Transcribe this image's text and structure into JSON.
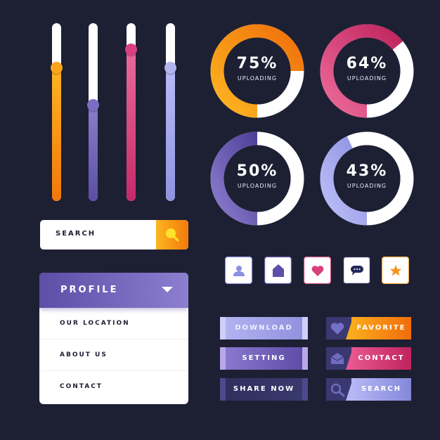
{
  "sliders": [
    {
      "name": "orange",
      "value": 0.75,
      "colors": [
        "#f2770b",
        "#fdb521"
      ],
      "knob": "#fba51b"
    },
    {
      "name": "purple",
      "value": 0.54,
      "colors": [
        "#5a4fa3",
        "#8a7fcc"
      ],
      "knob": "#7a6ec4"
    },
    {
      "name": "pink",
      "value": 0.85,
      "colors": [
        "#c52a68",
        "#ea6a9a"
      ],
      "knob": "#d94080"
    },
    {
      "name": "lavender",
      "value": 0.75,
      "colors": [
        "#8f93df",
        "#b9bcf7"
      ],
      "knob": "#b2b5ee"
    }
  ],
  "progress_rings": [
    {
      "percent_label": "75%",
      "value": 0.75,
      "status": "UPLOADING",
      "colors": [
        "#fdb521",
        "#f0700b"
      ]
    },
    {
      "percent_label": "64%",
      "value": 0.64,
      "status": "UPLOADING",
      "colors": [
        "#ec6a9a",
        "#c0255f"
      ]
    },
    {
      "percent_label": "50%",
      "value": 0.5,
      "status": "UPLOADING",
      "colors": [
        "#8a7ccc",
        "#4f3f9a"
      ]
    },
    {
      "percent_label": "43%",
      "value": 0.43,
      "status": "UPLOADING",
      "colors": [
        "#bcbff8",
        "#8a8edf"
      ]
    }
  ],
  "search_bar": {
    "placeholder": "SEARCH",
    "icon": "search-icon"
  },
  "profile_menu": {
    "title": "PROFILE",
    "items": [
      {
        "label": "OUR LOCATION"
      },
      {
        "label": "ABOUT US"
      },
      {
        "label": "CONTACT"
      }
    ]
  },
  "icon_tiles": [
    {
      "icon": "user-icon",
      "border": "#9a9ce6"
    },
    {
      "icon": "home-icon",
      "border": "#6c62b8"
    },
    {
      "icon": "heart-icon",
      "border": "#e05a8e"
    },
    {
      "icon": "chat-icon",
      "border": "#2a2c55"
    },
    {
      "icon": "star-icon",
      "border": "#f8b24a"
    }
  ],
  "plain_buttons": [
    {
      "label": "DOWNLOAD",
      "colors": [
        "#b4b5f2",
        "#8f8fdd"
      ],
      "cap": "#cfd0fa",
      "text": "#eef0ff"
    },
    {
      "label": "SETTING",
      "colors": [
        "#8b7bd0",
        "#5a4aa6"
      ],
      "cap": "#b7a9e6",
      "text": "#ffffff"
    },
    {
      "label": "SHARE NOW",
      "colors": [
        "#2f2e5c",
        "#3b3a70"
      ],
      "cap": "#4b4a8c",
      "text": "#ffffff"
    }
  ],
  "icon_buttons": [
    {
      "label": "FAVORITE",
      "icon": "heart-icon",
      "colors": [
        "#fbab1d",
        "#f06d0b"
      ]
    },
    {
      "label": "CONTACT",
      "icon": "envelope-icon",
      "colors": [
        "#e8578f",
        "#c0235d"
      ]
    },
    {
      "label": "SEARCH",
      "icon": "search-icon",
      "colors": [
        "#b6b8f5",
        "#8488da"
      ]
    }
  ]
}
